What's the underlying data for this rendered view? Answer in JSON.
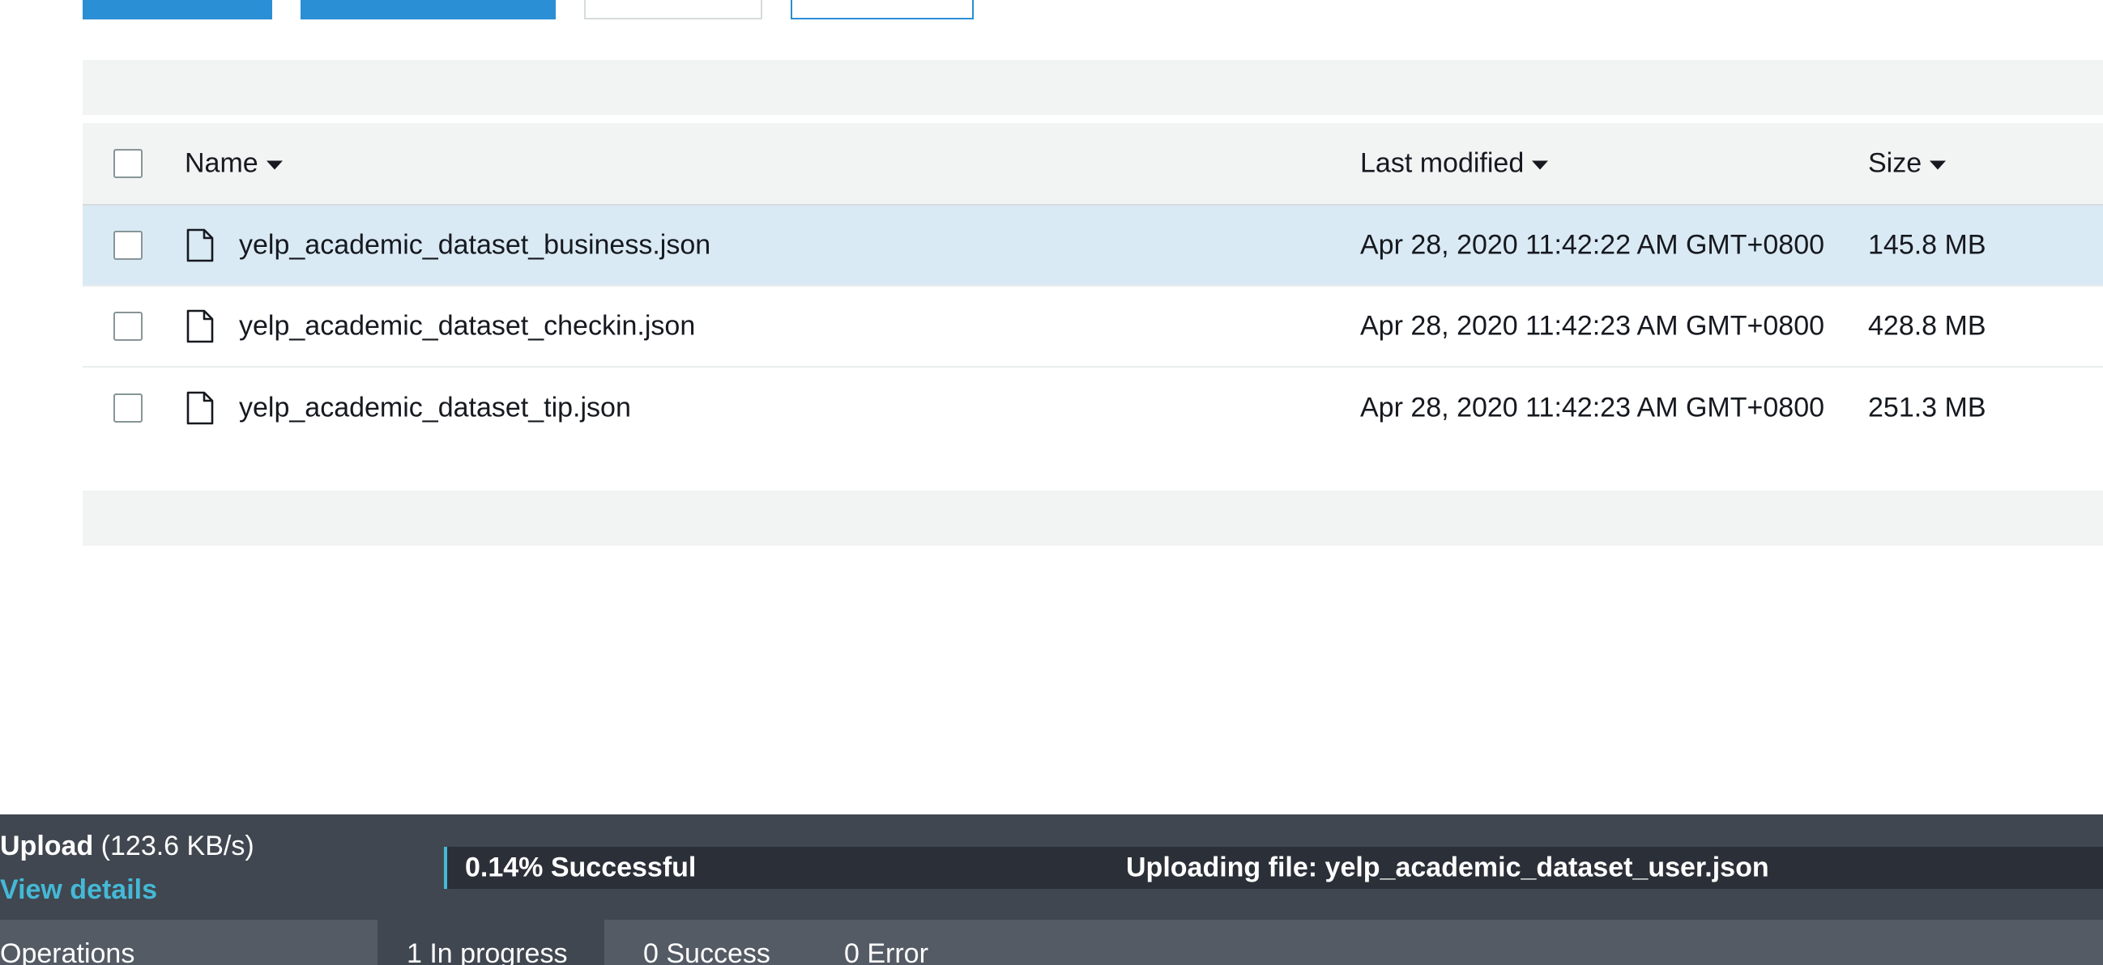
{
  "table": {
    "headers": {
      "name": "Name",
      "last_modified": "Last modified",
      "size": "Size"
    },
    "rows": [
      {
        "name": "yelp_academic_dataset_business.json",
        "last_modified": "Apr 28, 2020 11:42:22 AM GMT+0800",
        "size": "145.8 MB",
        "selected": true
      },
      {
        "name": "yelp_academic_dataset_checkin.json",
        "last_modified": "Apr 28, 2020 11:42:23 AM GMT+0800",
        "size": "428.8 MB",
        "selected": false
      },
      {
        "name": "yelp_academic_dataset_tip.json",
        "last_modified": "Apr 28, 2020 11:42:23 AM GMT+0800",
        "size": "251.3 MB",
        "selected": false
      }
    ]
  },
  "upload": {
    "title": "Upload",
    "speed": "(123.6 KB/s)",
    "view_details": "View details",
    "progress_percent": 0.14,
    "progress_label": "0.14% Successful",
    "status_text": "Uploading file: yelp_academic_dataset_user.json",
    "tabs": [
      {
        "label": "Operations"
      },
      {
        "label": "1 In progress"
      },
      {
        "label": "0 Success"
      },
      {
        "label": "0 Error"
      }
    ]
  },
  "colors": {
    "accent": "#2a8fd4",
    "selected_row": "#daeaf5",
    "progress_fill": "#44b9d6",
    "upload_bar": "#414750"
  }
}
